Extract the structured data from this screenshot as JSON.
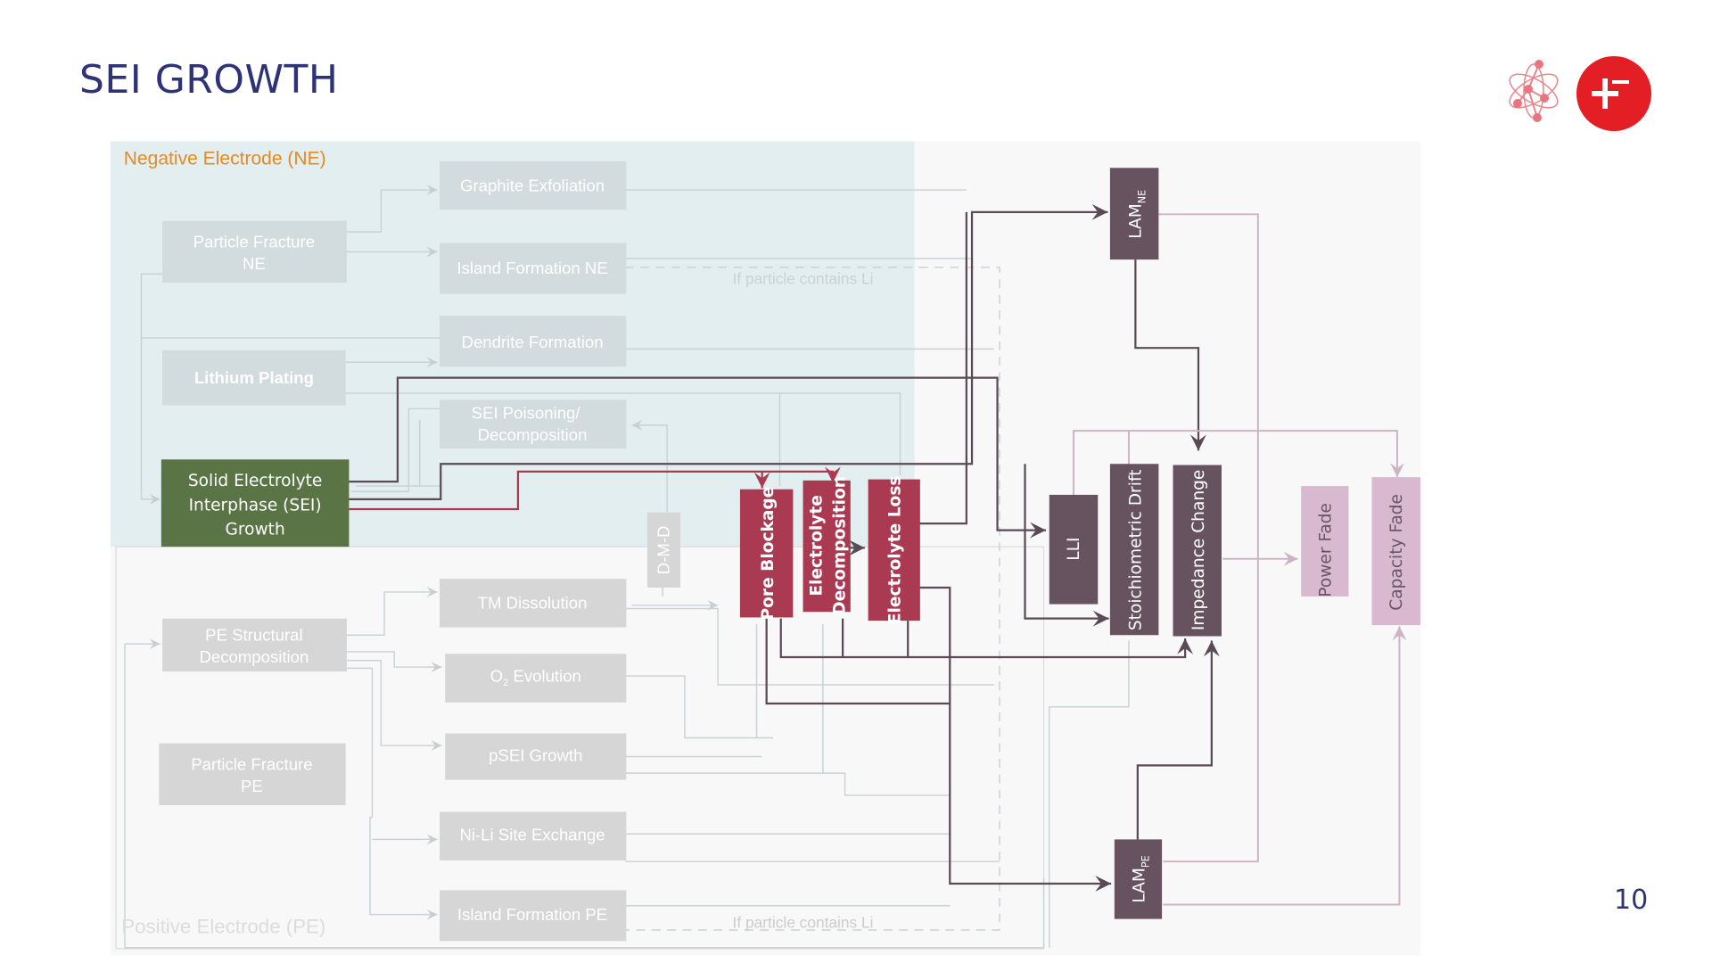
{
  "slide": {
    "title": "SEI GROWTH",
    "page_number": "10"
  },
  "logos": {
    "atom_icon": "atom-molecule-icon",
    "brand_icon": "plus-minus-circle-icon",
    "brand_color": "#e31e24"
  },
  "regions": {
    "negative_electrode": "Negative Electrode (NE)",
    "positive_electrode": "Positive Electrode (PE)"
  },
  "colors": {
    "ne_region_bg": "#e3eef1",
    "pe_region_bg": "#f7f7f7",
    "faded_box": "#d2dbde",
    "faded_box_pe": "#d6d6d6",
    "sei_highlight": "#5a7446",
    "effect_red": "#a93a52",
    "mode_dark": "#67535f",
    "outcome_light": "#d8b9d0",
    "title_navy": "#2e3378",
    "ne_label_orange": "#e58a1f"
  },
  "ne_mechanisms": [
    {
      "id": "particle-fracture-ne",
      "label_lines": [
        "Particle Fracture",
        "NE"
      ]
    },
    {
      "id": "graphite-exfoliation",
      "label_lines": [
        "Graphite Exfoliation"
      ]
    },
    {
      "id": "island-formation-ne",
      "label_lines": [
        "Island Formation NE"
      ]
    },
    {
      "id": "dendrite-formation",
      "label_lines": [
        "Dendrite Formation"
      ]
    },
    {
      "id": "lithium-plating",
      "label_lines": [
        "Lithium Plating"
      ]
    },
    {
      "id": "sei-poisoning",
      "label_lines": [
        "SEI Poisoning/",
        "Decomposition"
      ]
    },
    {
      "id": "sei-growth",
      "label_lines": [
        "Solid Electrolyte",
        "Interphase (SEI)",
        "Growth"
      ],
      "highlighted": true
    }
  ],
  "pe_mechanisms": [
    {
      "id": "pe-structural-decomposition",
      "label_lines": [
        "PE Structural",
        "Decomposition"
      ]
    },
    {
      "id": "tm-dissolution",
      "label_lines": [
        "TM Dissolution"
      ]
    },
    {
      "id": "o2-evolution",
      "label_main": "O",
      "label_sub": "2",
      "label_rest": " Evolution"
    },
    {
      "id": "psei-growth",
      "label_lines": [
        "pSEI Growth"
      ]
    },
    {
      "id": "particle-fracture-pe",
      "label_lines": [
        "Particle Fracture",
        "PE"
      ]
    },
    {
      "id": "ni-li-site-exchange",
      "label_lines": [
        "Ni-Li Site Exchange"
      ]
    },
    {
      "id": "island-formation-pe",
      "label_lines": [
        "Island Formation PE"
      ]
    }
  ],
  "shared_mechanism": {
    "id": "d-m-d",
    "label": "D-M-D"
  },
  "effects": [
    {
      "id": "pore-blockage",
      "label_lines": [
        "Pore Blockage"
      ]
    },
    {
      "id": "electrolyte-decomposition",
      "label_lines": [
        "Electrolyte",
        "Decomposition"
      ]
    },
    {
      "id": "electrolyte-loss",
      "label_lines": [
        "Electrolyte Loss"
      ]
    }
  ],
  "modes": [
    {
      "id": "lam-ne",
      "label_main": "LAM",
      "label_sub": "NE"
    },
    {
      "id": "lli",
      "label_main": "LLI"
    },
    {
      "id": "stoichiometric-drift",
      "label_main": "Stoichiometric Drift"
    },
    {
      "id": "impedance-change",
      "label_main": "Impedance Change"
    },
    {
      "id": "lam-pe",
      "label_main": "LAM",
      "label_sub": "PE"
    }
  ],
  "outcomes": [
    {
      "id": "power-fade",
      "label": "Power Fade"
    },
    {
      "id": "capacity-fade",
      "label": "Capacity Fade"
    }
  ],
  "annotations": {
    "condition_ne": "If particle contains Li",
    "condition_pe": "If particle contains Li"
  }
}
